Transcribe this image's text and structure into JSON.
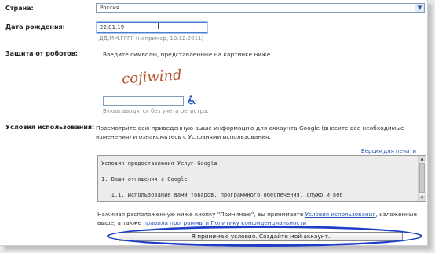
{
  "country": {
    "label": "Страна:",
    "value": "Россия"
  },
  "birthdate": {
    "label": "Дата рождения:",
    "value": "22.01.19",
    "hint": "ДД.ММ.ГГГГ (например, 10.12.2011)"
  },
  "robot": {
    "label": "Защита от роботов:",
    "instruction": "Введите символы, представленные на картинке ниже.",
    "captcha_text": "cojiwind",
    "case_hint": "Буквы вводятся без учета регистра."
  },
  "terms": {
    "label": "Условия использования:",
    "intro": "Просмотрите всю приведенную выше информацию для аккаунта Google (внесите все необходимые изменения) и ознакомьтесь с Условиями использования.",
    "print_link": "Версия для печати",
    "box_lines": [
      "Условия предоставления Услуг Google",
      "",
      "1. Ваши отношения с Google",
      "",
      "   1.1. Использование вами товаров, программного обеспечения, служб и веб"
    ]
  },
  "accept": {
    "text_before": "Нажимая расположенную ниже кнопку \"Принимаю\", вы принимаете",
    "link1": "Условия использования",
    "text_mid": ", изложенные выше, а также",
    "link2": "правила программы и Политику конфиденциальности",
    "button_label": "Я принимаю условия. Создайте мой аккаунт."
  },
  "colors": {
    "link": "#2a4fb8",
    "highlight_ellipse": "#1f3ec8",
    "focus_border": "#4b7bd1"
  },
  "icons": {
    "select_arrow": "chevron-down-icon",
    "accessibility": "wheelchair-icon",
    "text_cursor": "text-cursor-icon"
  }
}
